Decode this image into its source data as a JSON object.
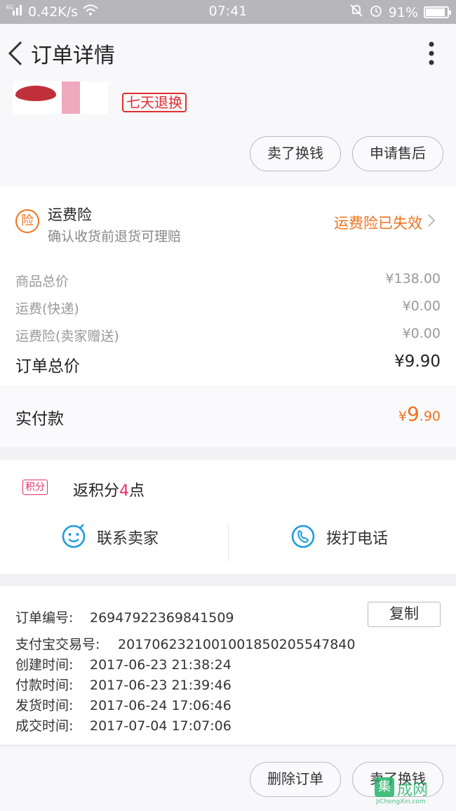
{
  "status_bar": {
    "network": "4G",
    "speed": "0.42K/s",
    "time": "07:41",
    "battery": "91%",
    "battery_level": 0.91
  },
  "nav": {
    "title": "订单详情"
  },
  "product": {
    "return_tag": "七天退换",
    "btn_sell": "卖了换钱",
    "btn_after_sale": "申请售后"
  },
  "insurance": {
    "icon_char": "险",
    "title": "运费险",
    "subtitle": "确认收货前退货可理赔",
    "status": "运费险已失效"
  },
  "fees": [
    {
      "label": "商品总价",
      "value": "¥138.00"
    },
    {
      "label": "运费(快递)",
      "value": "¥0.00"
    },
    {
      "label": "运费险(卖家赠送)",
      "value": "¥0.00"
    }
  ],
  "order_total": {
    "label": "订单总价",
    "value": "¥9.90"
  },
  "paid": {
    "label": "实付款",
    "currency": "¥",
    "int": "9",
    "dec": ".90"
  },
  "points": {
    "badge": "积分",
    "prefix": "返积分",
    "count": "4",
    "suffix": "点"
  },
  "contact": {
    "seller": "联系卖家",
    "call": "拨打电话"
  },
  "order_info": {
    "copy_label": "复制",
    "lines": [
      {
        "key": "订单编号:",
        "value": "26947922369841509"
      },
      {
        "key": "支付宝交易号:",
        "value": "2017062321001001850205547840"
      },
      {
        "key": "创建时间:",
        "value": "2017-06-23 21:38:24"
      },
      {
        "key": "付款时间:",
        "value": "2017-06-23 21:39:46"
      },
      {
        "key": "发货时间:",
        "value": "2017-06-24 17:06:46"
      },
      {
        "key": "成交时间:",
        "value": "2017-07-04 17:07:06"
      }
    ]
  },
  "bottom": {
    "delete_order": "删除订单",
    "sell_for_cash": "卖了换钱"
  },
  "watermark": {
    "mark": "集",
    "cn": "成网",
    "en": "JiChengXin.com"
  },
  "colors": {
    "accent_orange": "#f0731e",
    "points_pink": "#e8306a",
    "contact_blue": "#1e9be0"
  }
}
